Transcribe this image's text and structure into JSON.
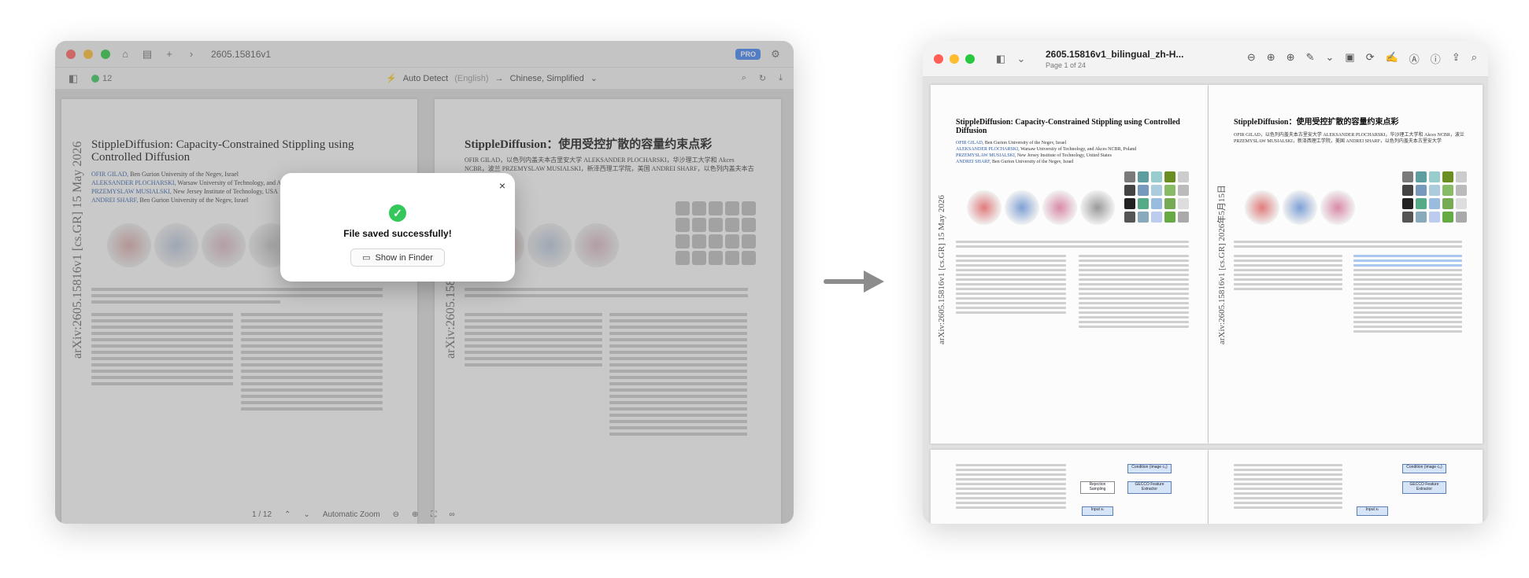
{
  "left_app": {
    "tab_title": "2605.15816v1",
    "pro_badge": "PRO",
    "count": "12",
    "source_lang": "Auto Detect",
    "source_lang_hint": "(English)",
    "arrow": "→",
    "target_lang": "Chinese, Simplified",
    "left_page": {
      "title": "StippleDiffusion: Capacity-Constrained Stippling using Controlled Diffusion",
      "author1": "OFIR GILAD,",
      "author1_aff": "Ben Gurion University of the Negev, Israel",
      "author2": "ALEKSANDER PLOCHARSKI,",
      "author2_aff": "Warsaw University of Technology, and Akces NCBR, Poland",
      "author3": "PRZEMYSLAW MUSIALSKI,",
      "author3_aff": "New Jersey Institute of Technology, USA",
      "author4": "ANDREI SHARF,",
      "author4_aff": "Ben Gurion University of the Negev, Israel",
      "side_label": "arXiv:2605.15816v1 [cs.GR] 15 May 2026"
    },
    "right_page": {
      "title": "StippleDiffusion：使用受控扩散的容量约束点彩",
      "authors": "OFIR GILAD，以色列内盖夫本古里安大学 ALEKSANDER PLOCHARSKI，华沙理工大学和 Akces NCBR，波兰 PRZEMYSLAW MUSIALSKI，新泽西理工学院，美国 ANDREI SHARF，以色列内盖夫本古里安大学",
      "side_label": "arXiv:2605.15816v1"
    },
    "footer": {
      "page_indicator": "1 / 12",
      "zoom": "Automatic Zoom"
    },
    "dialog": {
      "message": "File saved successfully!",
      "button": "Show in Finder",
      "close": "×"
    }
  },
  "right_app": {
    "title": "2605.15816v1_bilingual_zh-H...",
    "subtitle": "Page 1 of 24",
    "page1": {
      "title": "StippleDiffusion: Capacity-Constrained Stippling using Controlled Diffusion",
      "author1": "OFIR GILAD,",
      "author1_aff": "Ben Gurion University of the Negev, Israel",
      "author2": "ALEKSANDER PLOCHARSKI,",
      "author2_aff": "Warsaw University of Technology, and Akces NCBR, Poland",
      "author3": "PRZEMYSLAW MUSIALSKI,",
      "author3_aff": "New Jersey Institute of Technology, United States",
      "author4": "ANDREI SHARF,",
      "author4_aff": "Ben Gurion University of the Negev, Israel",
      "side_label": "arXiv:2605.15816v1 [cs.GR] 15 May 2026"
    },
    "page2": {
      "title": "StippleDiffusion：使用受控扩散的容量约束点彩",
      "authors": "OFIR GILAD，以色列内盖夫本古里安大学 ALEKSANDER PLOCHARSKI，华沙理工大学和 Akces NCBR，波兰 PRZEMYSLAW MUSIALSKI，新泽西理工学院，美国 ANDREI SHARF，以色列内盖夫本古里安大学",
      "side_label": "arXiv:2605.15816v1 [cs.GR] 2026年5月15日"
    },
    "diagram": {
      "cond": "Condition (image c₀)",
      "gecco": "GECCO Feature Extractor",
      "input": "Input xₜ",
      "rej": "Rejection Sampling"
    }
  },
  "colors": {
    "accent_blue": "#3b82f6",
    "success_green": "#34c759",
    "link_blue": "#2b5aa8",
    "highlight": "#a9c7ef"
  }
}
